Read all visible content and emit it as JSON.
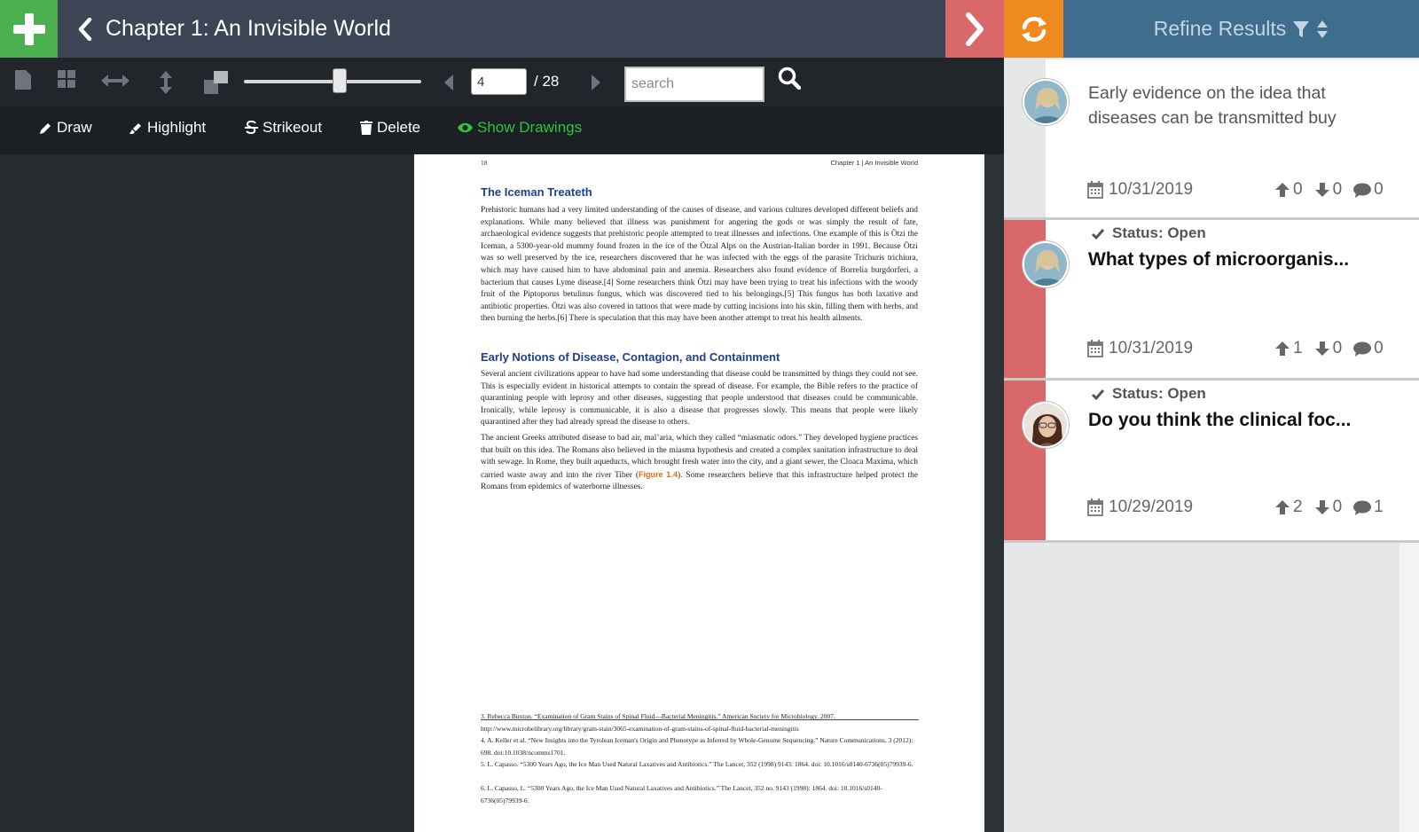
{
  "header": {
    "title": "Chapter 1: An Invisible World",
    "refine_label": "Refine Results"
  },
  "toolbar": {
    "page_value": "4",
    "page_total": "/ 28",
    "search_placeholder": "search"
  },
  "draw_toolbar": {
    "draw": "Draw",
    "highlight": "Highlight",
    "strikeout": "Strikeout",
    "delete": "Delete",
    "show_drawings": "Show Drawings"
  },
  "document": {
    "page_number": "18",
    "running_head": "Chapter 1 | An Invisible World",
    "heading1": "The Iceman Treateth",
    "para1": "Prehistoric humans had a very limited understanding of the causes of disease, and various cultures developed different beliefs and explanations. While many believed that illness was punishment for angering the gods or was simply the result of fate, archaeological evidence suggests that prehistoric people attempted to treat illnesses and infections. One example of this is Ötzi the Iceman, a 5300-year-old mummy found frozen in the ice of the Ötzal Alps on the Austrian-Italian border in 1991. Because Ötzi was so well preserved by the ice, researchers discovered that he was infected with the eggs of the parasite Trichuris trichiura, which may have caused him to have abdominal pain and anemia. Researchers also found evidence of Borrelia burgdorferi, a bacterium that causes Lyme disease.[4] Some researchers think Ötzi may have been trying to treat his infections with the woody fruit of the Piptoporus betulinus fungus, which was discovered tied to his belongings.[5] This fungus has both laxative and antibiotic properties. Ötzi was also covered in tattoos that were made by cutting incisions into his skin, filling them with herbs, and then burning the herbs.[6] There is speculation that this may have been another attempt to treat his health ailments.",
    "heading2": "Early Notions of Disease, Contagion, and Containment",
    "para2": "Several ancient civilizations appear to have had some understanding that disease could be transmitted by things they could not see. This is especially evident in historical attempts to contain the spread of disease. For example, the Bible refers to the practice of quarantining people with leprosy and other diseases, suggesting that people understood that diseases could be communicable. Ironically, while leprosy is communicable, it is also a disease that progresses slowly. This means that people were likely quarantined after they had already spread the disease to others.",
    "para3_a": "The ancient Greeks attributed disease to bad air, mal’aria, which they called “miasmatic odors.” They developed hygiene practices that built on this idea. The Romans also believed in the miasma hypothesis and created a complex sanitation infrastructure to deal with sewage. In Rome, they built aqueducts, which brought fresh water into the city, and a giant sewer, the Cloaca Maxima, which carried waste away and into the river Tiber (",
    "para3_fig": "Figure 1.4",
    "para3_b": "). Some researchers believe that this infrastructure helped protect the Romans from epidemics of waterborne illnesses.",
    "footnotes": [
      "3. Rebecca Buxton. “Examination of Gram Stains of Spinal Fluid—Bacterial Meningitis.” American Society for Microbiology. 2007. http://www.microbelibrary.org/library/gram-stain/3065-examination-of-gram-stains-of-spinal-fluid-bacterial-meningitis",
      "4. A. Keller et al. “New Insights into the Tyrolean Iceman's Origin and Phenotype as Inferred by Whole-Genome Sequencing.” Nature Communications, 3 (2012): 698. doi:10.1038/ncomms1701.",
      "5. L. Capasso. “5300 Years Ago, the Ice Man Used Natural Laxatives and Antibiotics.” The Lancet, 352 (1998) 9143: 1864. doi: 10.1016/s0140-6736(05)79939-6.",
      "6. L. Capasso, L. “5300 Years Ago, the Ice Man Used Natural Laxatives and Antibiotics.” The Lancet, 352 no. 9143 (1998): 1864. doi: 10.1016/s0140-6736(05)79939-6."
    ]
  },
  "cards": [
    {
      "text": "Early evidence on the idea that diseases can be transmitted buy",
      "date": "10/31/2019",
      "up": "0",
      "down": "0",
      "comments": "0",
      "strip_color": "#e6e7e8"
    },
    {
      "status": "Status: Open",
      "title": "What types of microorganis...",
      "date": "10/31/2019",
      "up": "1",
      "down": "0",
      "comments": "0",
      "strip_color": "#d9686a"
    },
    {
      "status": "Status: Open",
      "title": "Do you think the clinical foc...",
      "date": "10/29/2019",
      "up": "2",
      "down": "0",
      "comments": "1",
      "strip_color": "#d9686a"
    }
  ]
}
